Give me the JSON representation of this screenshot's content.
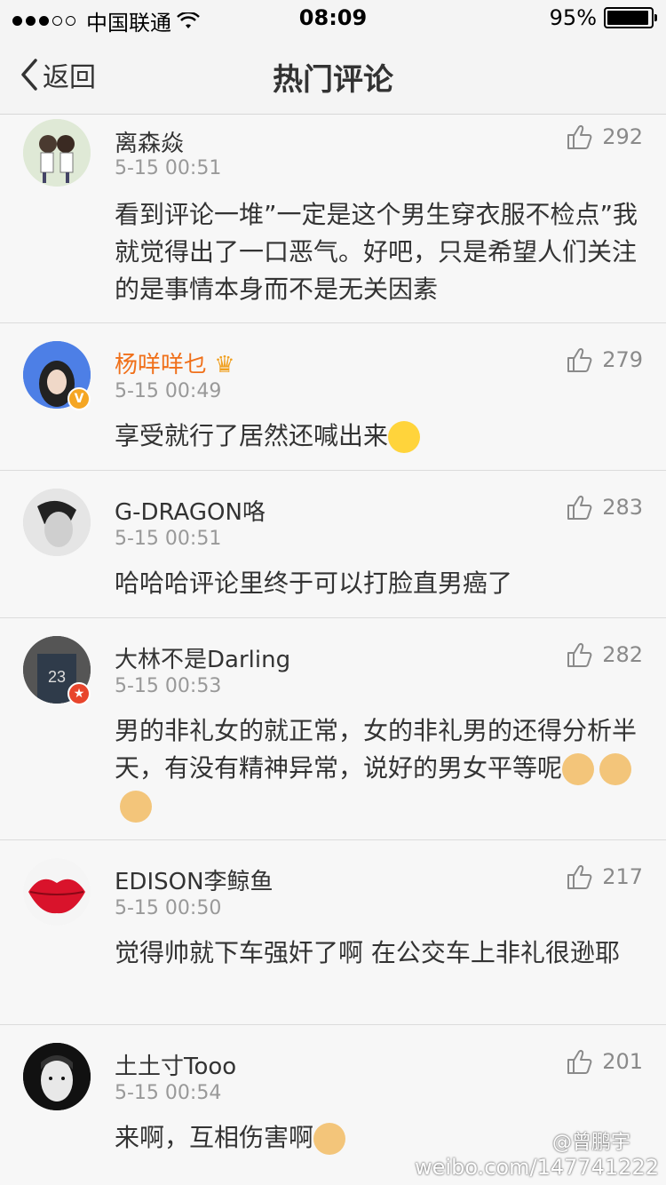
{
  "status": {
    "carrier": "中国联通",
    "time": "08:09",
    "battery": "95%",
    "battery_level": 0.95
  },
  "nav": {
    "back_label": "返回",
    "title": "热门评论"
  },
  "comments": [
    {
      "name": "离森焱",
      "time": "5-15 00:51",
      "likes": "292",
      "text": "看到评论一堆”一定是这个男生穿衣服不检点”我就觉得出了一口恶气。好吧，只是希望人们关注的是事情本身而不是无关因素"
    },
    {
      "name": "杨咩咩乜",
      "time": "5-15 00:49",
      "likes": "279",
      "text": "享受就行了居然还喊出来"
    },
    {
      "name": "G-DRAGON咯",
      "time": "5-15 00:51",
      "likes": "283",
      "text": "哈哈哈评论里终于可以打脸直男癌了"
    },
    {
      "name": "大林不是Darling",
      "time": "5-15 00:53",
      "likes": "282",
      "text": "男的非礼女的就正常，女的非礼男的还得分析半天，有没有精神异常，说好的男女平等呢"
    },
    {
      "name": "EDISON李鲸鱼",
      "time": "5-15 00:50",
      "likes": "217",
      "text": "觉得帅就下车强奸了啊 在公交车上非礼很逊耶"
    },
    {
      "name": "土土寸Tooo",
      "time": "5-15 00:54",
      "likes": "201",
      "text": "来啊，互相伤害啊"
    }
  ],
  "watermark": {
    "handle": "@曾鹏宇",
    "url": "weibo.com/147741222"
  },
  "colors": {
    "vip_name": "#f0701a",
    "verified_badge": "#f5a623",
    "star_badge": "#e8452c"
  }
}
